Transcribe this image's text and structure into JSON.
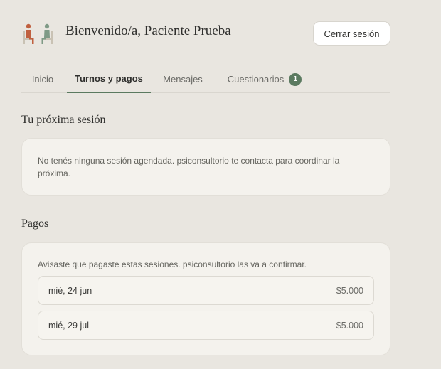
{
  "header": {
    "welcome": "Bienvenido/a, Paciente Prueba",
    "logout_label": "Cerrar sesión"
  },
  "tabs": [
    {
      "label": "Inicio",
      "active": false
    },
    {
      "label": "Turnos y pagos",
      "active": true
    },
    {
      "label": "Mensajes",
      "active": false
    },
    {
      "label": "Cuestionarios",
      "active": false,
      "badge": "1"
    }
  ],
  "next_session": {
    "title": "Tu próxima sesión",
    "message": "No tenés ninguna sesión agendada. psiconsultorio te contacta para coordinar la próxima."
  },
  "payments": {
    "title": "Pagos",
    "intro": "Avisaste que pagaste estas sesiones. psiconsultorio las va a confirmar.",
    "items": [
      {
        "date": "mié, 24 jun",
        "amount": "$5.000"
      },
      {
        "date": "mié, 29 jul",
        "amount": "$5.000"
      }
    ]
  },
  "colors": {
    "background": "#e9e6e0",
    "accent": "#5b7a60",
    "logo_terracotta": "#c0603f",
    "logo_sage": "#7f9a86"
  }
}
